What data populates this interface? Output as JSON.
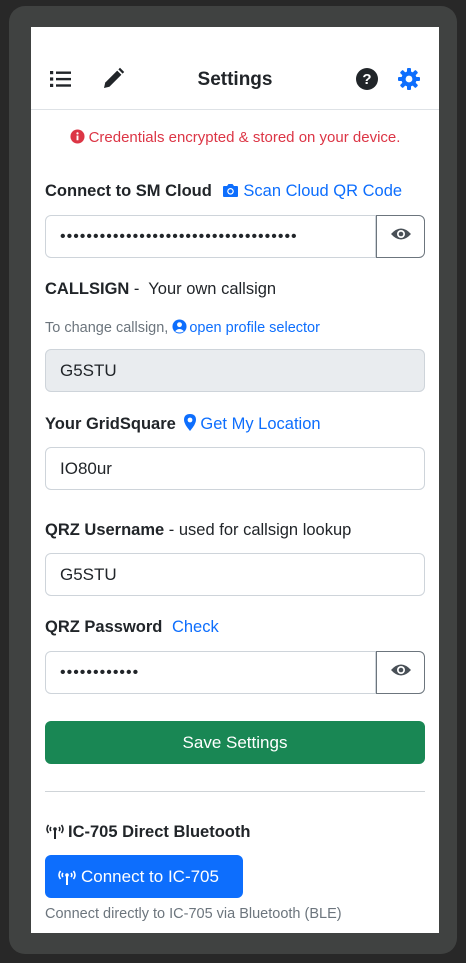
{
  "header": {
    "title": "Settings",
    "icons": [
      "list-icon",
      "pencil-icon",
      "help-icon",
      "gear-icon"
    ]
  },
  "alert": {
    "text": "Credentials encrypted & stored on your device.",
    "icon": "info-circle-icon",
    "color": "#dc3545"
  },
  "cloud": {
    "label": "Connect to SM Cloud",
    "scan_link": "Scan Cloud QR Code",
    "value": "••••••••••••••••••••••••••••••••••••",
    "toggle_icon": "eye-icon"
  },
  "callsign": {
    "label": "CALLSIGN",
    "suffix": " -  Your own callsign",
    "hint_prefix": "To change callsign,",
    "hint_link": "open profile selector",
    "value": "G5STU"
  },
  "grid": {
    "label": "Your GridSquare",
    "location_link": "Get My Location",
    "value": "IO80ur"
  },
  "qrz_user": {
    "label": "QRZ Username",
    "suffix": " - used for callsign lookup",
    "value": "G5STU"
  },
  "qrz_pass": {
    "label": "QRZ Password",
    "check_link": "Check",
    "value": "••••••••••••"
  },
  "save": {
    "label": "Save Settings",
    "color": "#198754"
  },
  "bluetooth": {
    "title": "IC-705 Direct Bluetooth",
    "button": "Connect to IC-705",
    "description": "Connect directly to IC-705 via Bluetooth (BLE)",
    "accent": "#0d6efd"
  }
}
